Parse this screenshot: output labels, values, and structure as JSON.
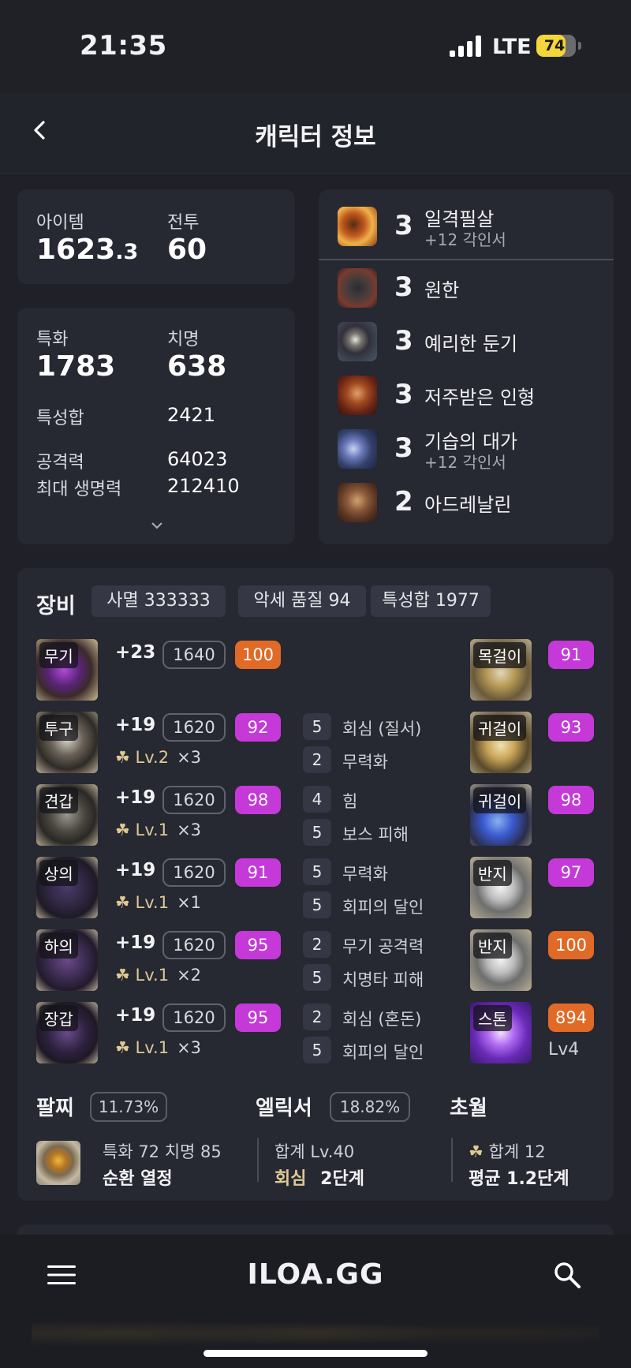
{
  "status": {
    "time": "21:35",
    "network": "LTE",
    "battery": "74",
    "battery_level": 0.74
  },
  "header": {
    "title": "캐릭터 정보"
  },
  "stats": {
    "item_label": "아이템",
    "item_value_main": "1623",
    "item_value_dec": ".3",
    "combat_label": "전투",
    "combat_value": "60",
    "spec_label": "특화",
    "spec_value": "1783",
    "crit_label": "치명",
    "crit_value": "638",
    "trait_sum_label": "특성합",
    "trait_sum_value": "2421",
    "attack_label": "공격력",
    "attack_value": "64023",
    "hp_label": "최대 생명력",
    "hp_value": "212410"
  },
  "engravings": [
    {
      "level": "3",
      "name": "일격필살",
      "sub": "+12 각인서",
      "icon": "fist-fire-icon"
    },
    {
      "level": "3",
      "name": "원한",
      "sub": "",
      "icon": "beast-icon"
    },
    {
      "level": "3",
      "name": "예리한 둔기",
      "sub": "",
      "icon": "mace-icon"
    },
    {
      "level": "3",
      "name": "저주받은 인형",
      "sub": "",
      "icon": "doll-icon"
    },
    {
      "level": "3",
      "name": "기습의 대가",
      "sub": "+12 각인서",
      "icon": "ambush-icon"
    },
    {
      "level": "2",
      "name": "아드레날린",
      "sub": "",
      "icon": "adrenaline-icon"
    }
  ],
  "equipment": {
    "title": "장비",
    "chips": [
      "사멸 333333",
      "악세 품질 94",
      "특성합 1977"
    ],
    "gear": [
      {
        "slot": "무기",
        "plus": "+23",
        "ilvl": "1640",
        "quality": "100",
        "qcolor": "#e06a26",
        "tier": "",
        "mult": "",
        "effects": []
      },
      {
        "slot": "투구",
        "plus": "+19",
        "ilvl": "1620",
        "quality": "92",
        "qcolor": "#c439d8",
        "tier": "Lv.2",
        "mult": "×3",
        "effects": [
          {
            "n": "5",
            "t": "회심 (질서)"
          },
          {
            "n": "2",
            "t": "무력화"
          }
        ]
      },
      {
        "slot": "견갑",
        "plus": "+19",
        "ilvl": "1620",
        "quality": "98",
        "qcolor": "#c439d8",
        "tier": "Lv.1",
        "mult": "×3",
        "effects": [
          {
            "n": "4",
            "t": "힘"
          },
          {
            "n": "5",
            "t": "보스 피해"
          }
        ]
      },
      {
        "slot": "상의",
        "plus": "+19",
        "ilvl": "1620",
        "quality": "91",
        "qcolor": "#c439d8",
        "tier": "Lv.1",
        "mult": "×1",
        "effects": [
          {
            "n": "5",
            "t": "무력화"
          },
          {
            "n": "5",
            "t": "회피의 달인"
          }
        ]
      },
      {
        "slot": "하의",
        "plus": "+19",
        "ilvl": "1620",
        "quality": "95",
        "qcolor": "#c439d8",
        "tier": "Lv.1",
        "mult": "×2",
        "effects": [
          {
            "n": "2",
            "t": "무기 공격력"
          },
          {
            "n": "5",
            "t": "치명타 피해"
          }
        ]
      },
      {
        "slot": "장갑",
        "plus": "+19",
        "ilvl": "1620",
        "quality": "95",
        "qcolor": "#c439d8",
        "tier": "Lv.1",
        "mult": "×3",
        "effects": [
          {
            "n": "2",
            "t": "회심 (혼돈)"
          },
          {
            "n": "5",
            "t": "회피의 달인"
          }
        ]
      }
    ],
    "accessories": [
      {
        "slot": "목걸이",
        "quality": "91",
        "qcolor": "#c439d8"
      },
      {
        "slot": "귀걸이",
        "quality": "93",
        "qcolor": "#c439d8"
      },
      {
        "slot": "귀걸이",
        "quality": "98",
        "qcolor": "#c439d8"
      },
      {
        "slot": "반지",
        "quality": "97",
        "qcolor": "#c439d8"
      },
      {
        "slot": "반지",
        "quality": "100",
        "qcolor": "#e06a26"
      },
      {
        "slot": "스톤",
        "quality": "894",
        "qcolor": "#e06a26",
        "extra": "Lv4"
      }
    ]
  },
  "bracelet": {
    "title": "팔찌",
    "pct": "11.73%",
    "line1": "특화 72  치명 85",
    "line2": "순환  열정"
  },
  "elixir": {
    "title": "엘릭서",
    "pct": "18.82%",
    "line1": "합계 Lv.40",
    "line2a": "회심",
    "line2b": "2단계"
  },
  "transcend": {
    "title": "초월",
    "line1": "합계 12",
    "line2": "평균 1.2단계"
  },
  "bottom": {
    "logo": "ILOA.GG"
  }
}
